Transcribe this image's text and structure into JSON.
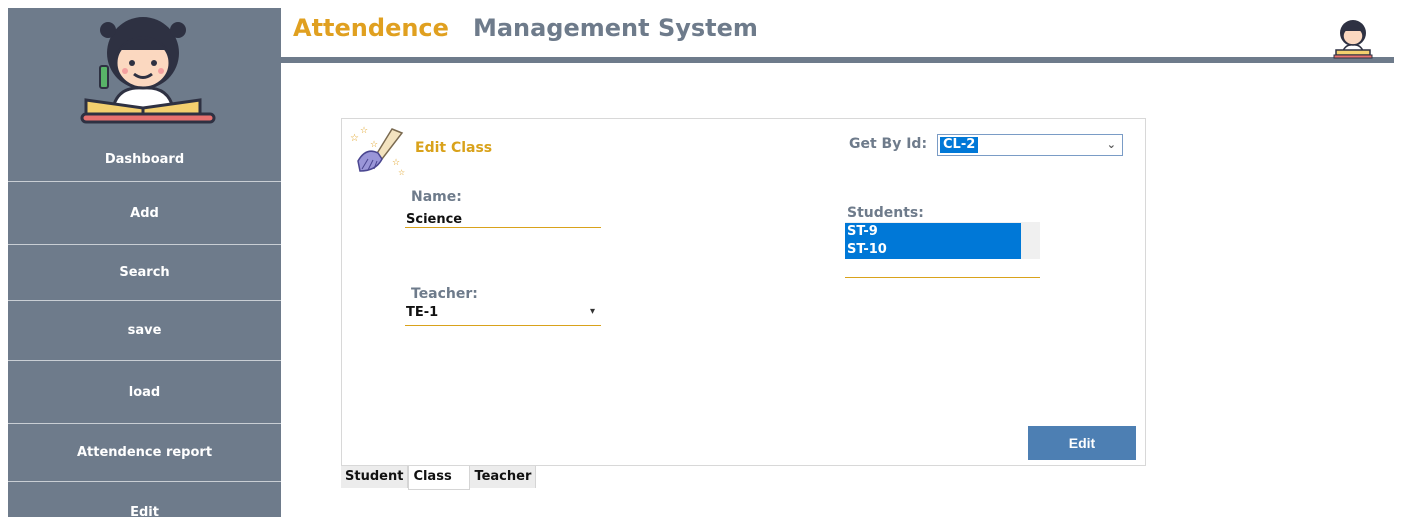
{
  "header": {
    "title_part1": "Attendence",
    "title_part2": "Management System"
  },
  "sidebar": {
    "items": [
      {
        "label": "Dashboard"
      },
      {
        "label": "Add"
      },
      {
        "label": "Search"
      },
      {
        "label": "save"
      },
      {
        "label": "load"
      },
      {
        "label": "Attendence report"
      },
      {
        "label": "Edit"
      }
    ]
  },
  "panel": {
    "title": "Edit Class",
    "get_by_id_label": "Get By Id:",
    "get_by_id_value": "CL-2",
    "name_label": "Name:",
    "name_value": "Science",
    "teacher_label": "Teacher:",
    "teacher_value": "TE-1",
    "students_label": "Students:",
    "students": [
      "ST-9",
      "ST-10"
    ],
    "edit_button": "Edit"
  },
  "tabs": [
    {
      "label": "Student"
    },
    {
      "label": "Class"
    },
    {
      "label": "Teacher"
    }
  ],
  "colors": {
    "sidebar": "#6e7b8b",
    "accent": "#e0a020",
    "button": "#4d7fb3",
    "selection": "#0078d7"
  }
}
